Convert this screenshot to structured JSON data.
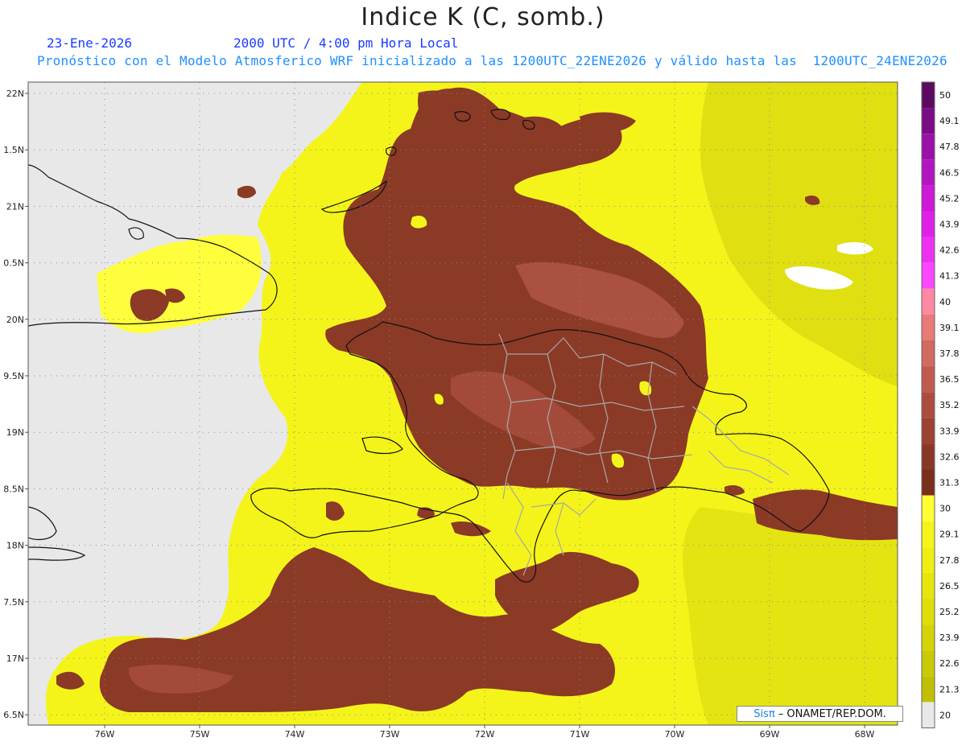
{
  "header": {
    "title": "Indice K (C, somb.)",
    "date": "23-Ene-2026",
    "time": "2000 UTC / 4:00 pm Hora Local",
    "forecast": "Pronóstico con el Modelo Atmosferico WRF inicializado a las 1200UTC_22ENE2026 y válido hasta las  1200UTC_24ENE2026"
  },
  "map": {
    "lat_labels": [
      "22N",
      "1.5N",
      "21N",
      "0.5N",
      "20N",
      "9.5N",
      "19N",
      "8.5N",
      "18N",
      "7.5N",
      "17N",
      "6.5N"
    ],
    "lon_labels": [
      "76W",
      "75W",
      "74W",
      "73W",
      "72W",
      "71W",
      "70W",
      "69W",
      "68W"
    ],
    "colors": {
      "land_grey": "#e8e8e8",
      "yellow_low": "#e6e600",
      "yellow": "#f4f41a",
      "yellow_bright": "#ffff33",
      "brown": "#8b3a26",
      "brown_light": "#b0513f",
      "coast": "#111111",
      "border_grey": "#a8a8a8"
    }
  },
  "colorbar": {
    "labels": [
      "50",
      "49.1",
      "47.8",
      "46.5",
      "45.2",
      "43.9",
      "42.6",
      "41.3",
      "40",
      "39.1",
      "37.8",
      "36.5",
      "35.2",
      "33.9",
      "32.6",
      "31.3",
      "30",
      "29.1",
      "27.8",
      "26.5",
      "25.2",
      "23.9",
      "22.6",
      "21.3",
      "20"
    ],
    "swatches": [
      "#5c0a60",
      "#7a0c86",
      "#9a10a8",
      "#b314c2",
      "#cc1ad8",
      "#e020e8",
      "#ee30f2",
      "#fa46ff",
      "#ff88a0",
      "#e87a78",
      "#d06a62",
      "#c05a4e",
      "#ac4c3e",
      "#9c4232",
      "#8a3826",
      "#7a2e1c",
      "#ffff33",
      "#f4f41a",
      "#eeee12",
      "#e6e60c",
      "#dede08",
      "#d4d404",
      "#caca02",
      "#c0c000",
      "#e8e8e8"
    ]
  },
  "credit": {
    "brand": "Sisπ",
    "text": " – ONAMET/REP.DOM."
  }
}
